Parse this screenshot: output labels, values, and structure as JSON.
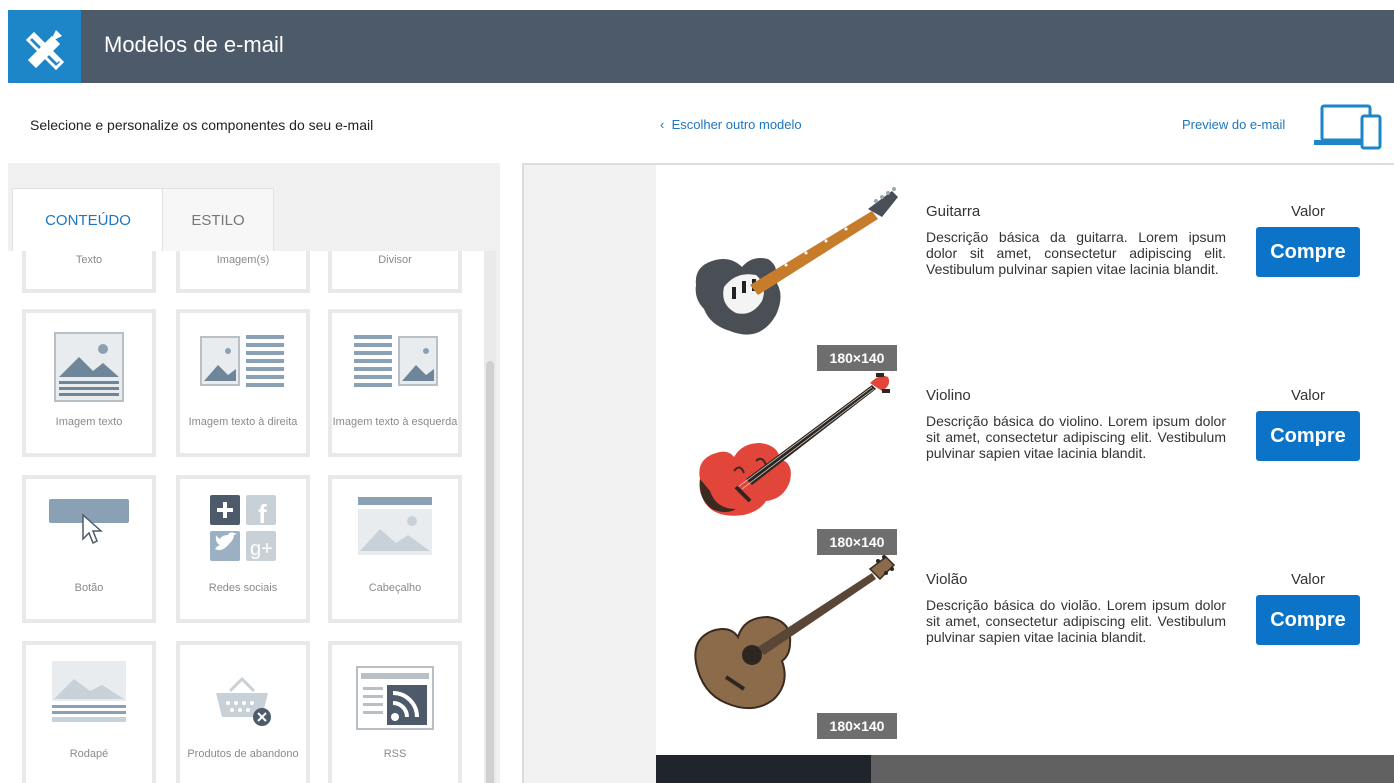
{
  "header": {
    "title": "Modelos de e-mail",
    "logo_icon": "pencil-ruler-icon",
    "accent_color": "#1d86c8",
    "bar_color": "#4d5a6a"
  },
  "subheader": {
    "instructions": "Selecione e personalize os componentes do seu e-mail",
    "back_label": "Escolher outro modelo",
    "preview_label": "Preview do e-mail"
  },
  "tabs": [
    {
      "label": "CONTEÚDO",
      "active": true
    },
    {
      "label": "ESTILO",
      "active": false
    }
  ],
  "components": [
    {
      "label": "Texto",
      "icon": "text-icon"
    },
    {
      "label": "Imagem(s)",
      "icon": "image-icon"
    },
    {
      "label": "Divisor",
      "icon": "divider-icon"
    },
    {
      "label": "Imagem texto",
      "icon": "image-text-icon"
    },
    {
      "label": "Imagem texto à direita",
      "icon": "image-text-right-icon"
    },
    {
      "label": "Imagem texto à esquerda",
      "icon": "image-text-left-icon"
    },
    {
      "label": "Botão",
      "icon": "button-icon"
    },
    {
      "label": "Redes sociais",
      "icon": "social-icon"
    },
    {
      "label": "Cabeçalho",
      "icon": "header-icon"
    },
    {
      "label": "Rodapé",
      "icon": "footer-icon"
    },
    {
      "label": "Produtos de abandono",
      "icon": "cart-abandon-icon"
    },
    {
      "label": "RSS",
      "icon": "rss-icon"
    }
  ],
  "products": [
    {
      "name": "Guitarra",
      "description": "Descrição básica da guitarra. Lorem ipsum dolor sit amet, consectetur adipiscing elit. Vestibulum pulvinar sapien vitae lacinia blandit.",
      "price_label": "Valor",
      "button": "Compre",
      "size": "180×140",
      "icon": "electric-guitar-icon"
    },
    {
      "name": "Violino",
      "description": "Descrição básica do violino. Lorem ipsum dolor sit amet, consectetur adipiscing elit. Vestibulum pulvinar sapien vitae lacinia blandit.",
      "price_label": "Valor",
      "button": "Compre",
      "size": "180×140",
      "icon": "violin-icon"
    },
    {
      "name": "Violão",
      "description": "Descrição básica do violão. Lorem ipsum dolor sit amet, consectetur adipiscing elit. Vestibulum pulvinar sapien vitae lacinia blandit.",
      "price_label": "Valor",
      "button": "Compre",
      "size": "180×140",
      "icon": "acoustic-guitar-icon"
    }
  ],
  "colors": {
    "link": "#1d76c0",
    "buy_button": "#0b74c9"
  }
}
